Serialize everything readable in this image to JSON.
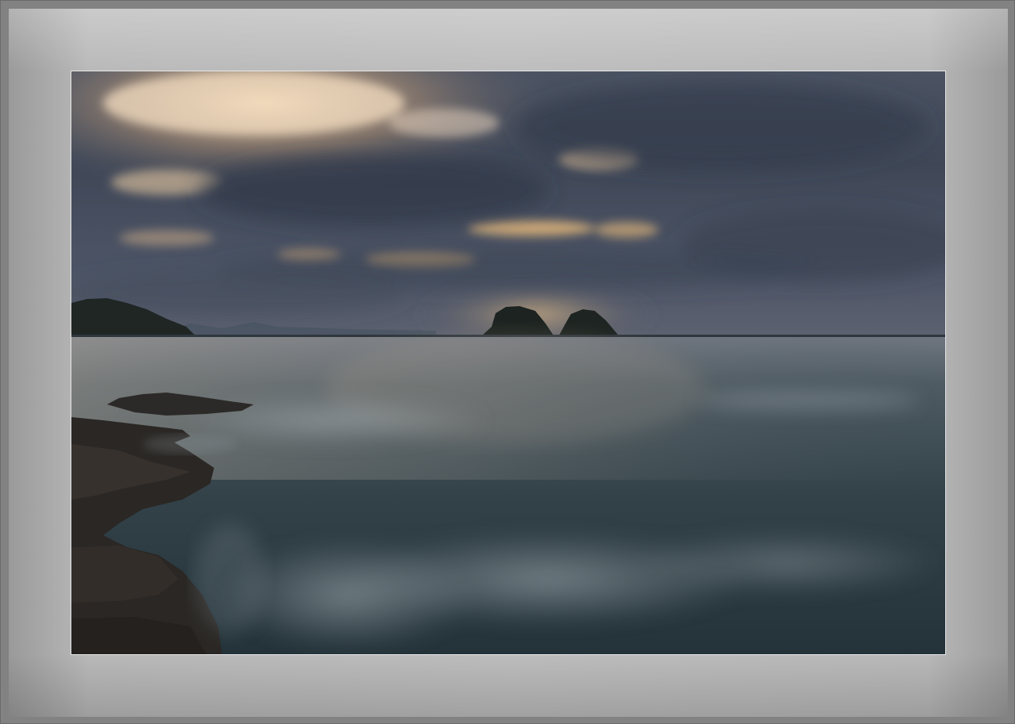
{
  "scene": {
    "description_icon": "seascape-photo-icon",
    "colors": {
      "mat": "#bdbdbd",
      "outer_border": "#7a7a7a",
      "photo_border": "#e8e8e8",
      "sky_dark": "#3b4452",
      "sky_light": "#e9c9a0",
      "sea": "#2f3f48",
      "rock": "#2a2724"
    }
  }
}
